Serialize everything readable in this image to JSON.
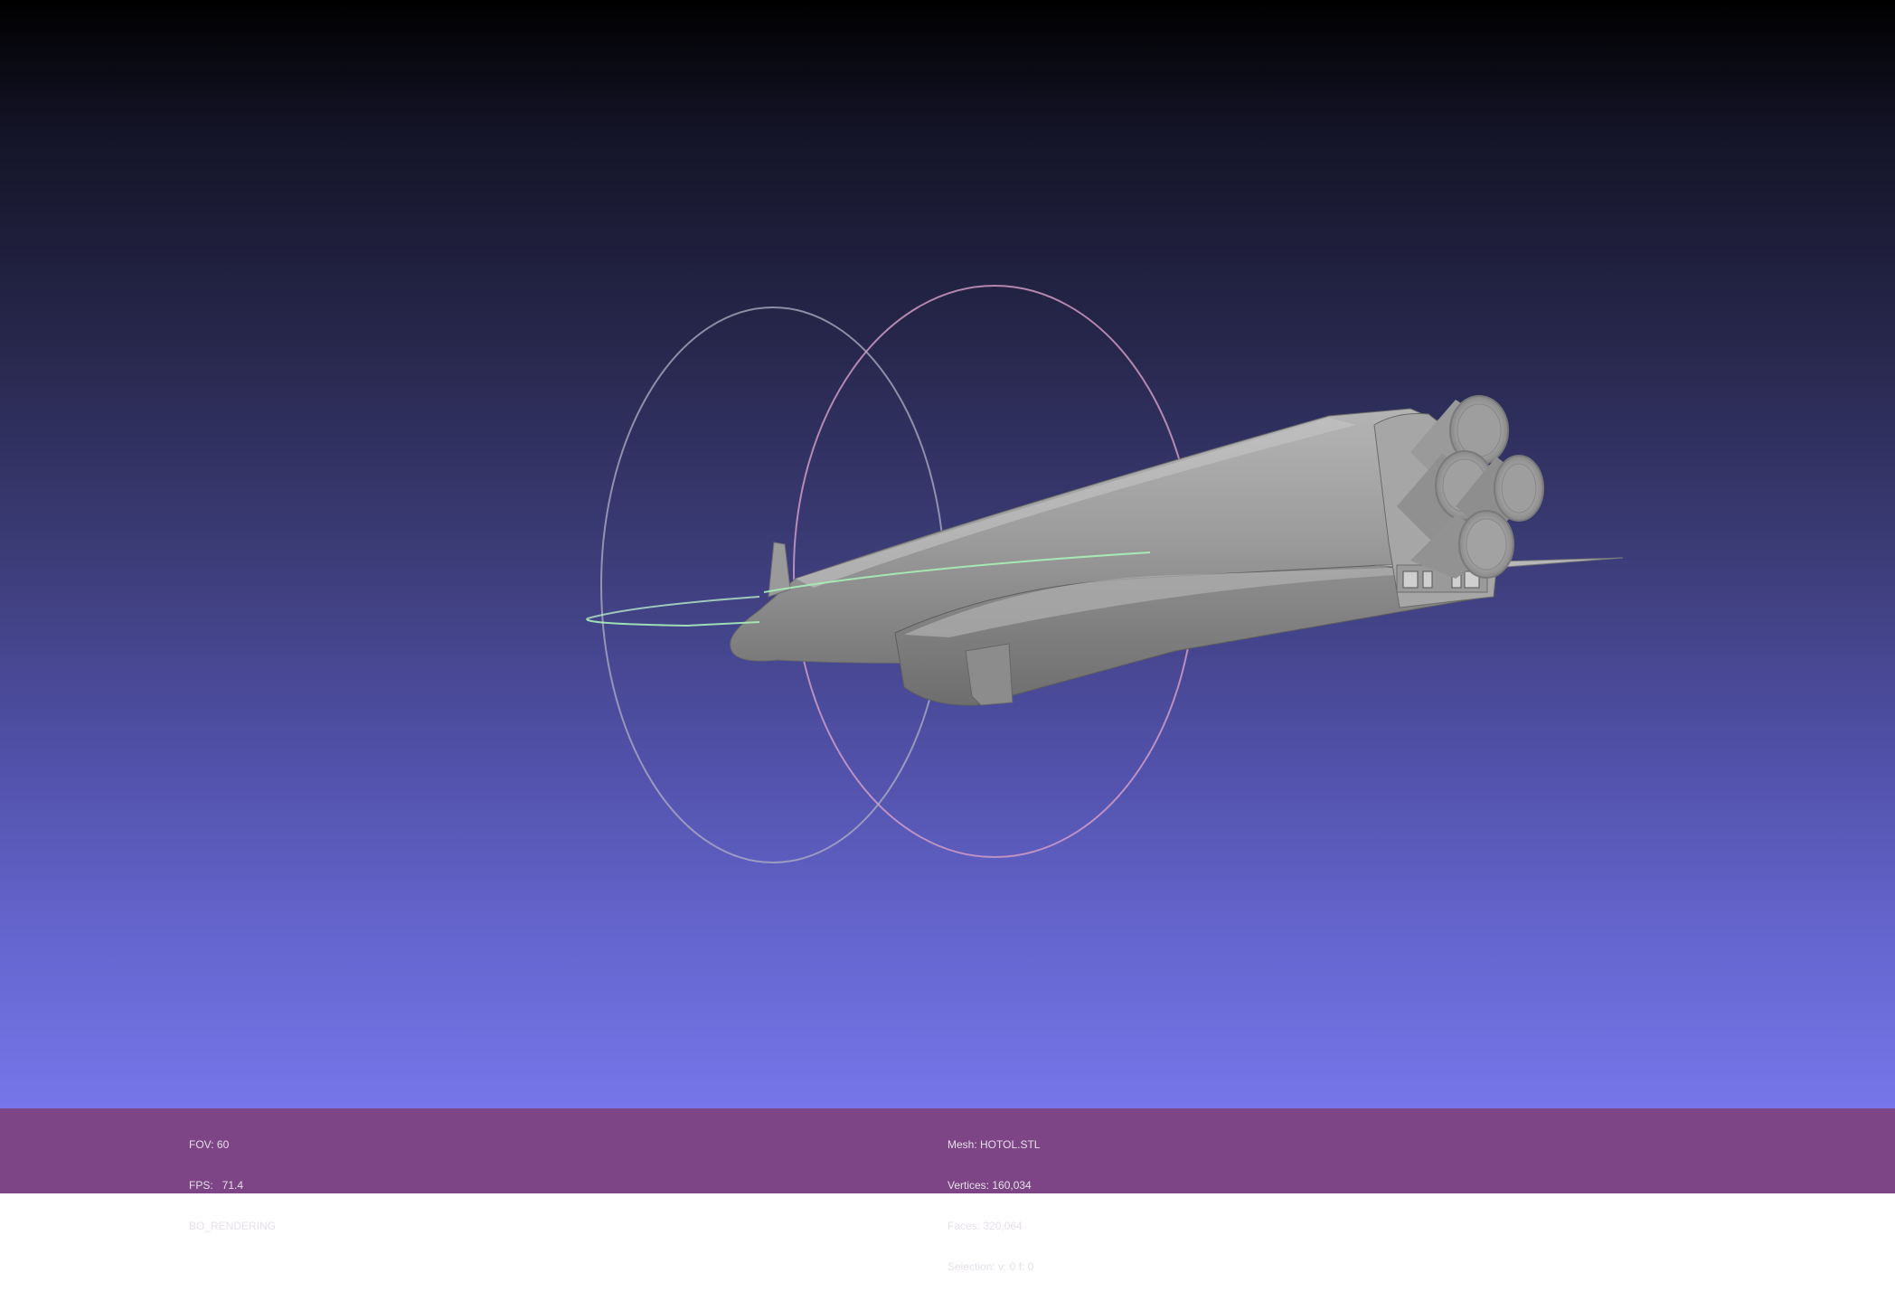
{
  "viewer": {
    "background_top": "#000000",
    "background_bottom": "#7676ea",
    "infobar_color": "#7d4585",
    "mesh_color": "#a8a8a8"
  },
  "trackball": {
    "circle_colors": [
      "#b8b8c8",
      "#e8a0c0",
      "#a0f0b0"
    ]
  },
  "render_info": {
    "fov": "FOV: 60",
    "fps": "FPS:   71.4",
    "mode": "BO_RENDERING"
  },
  "mesh_info": {
    "mesh": "Mesh: HOTOL.STL",
    "vertices": "Vertices: 160,034",
    "faces": "Faces: 320,064",
    "selection": "Selection: v: 0 f: 0"
  }
}
